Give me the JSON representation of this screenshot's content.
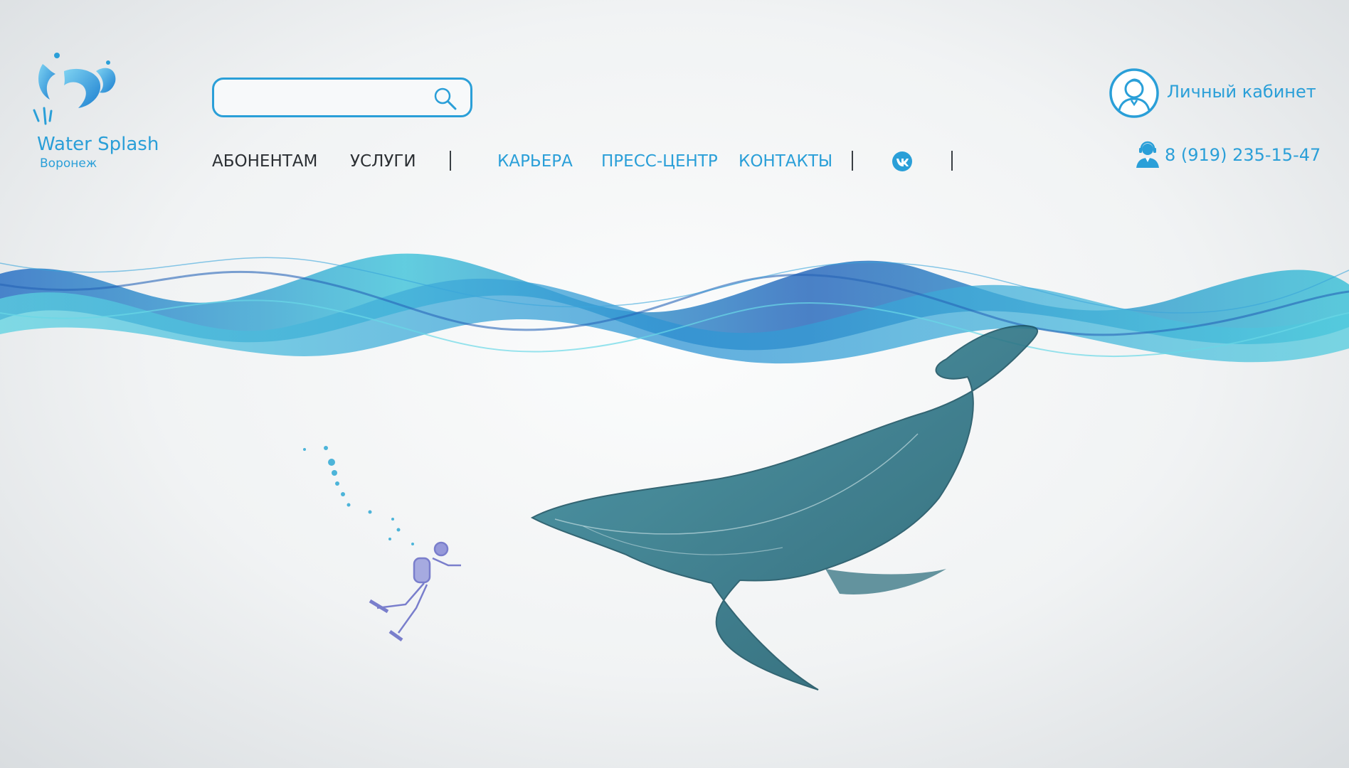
{
  "brand": {
    "name": "Water Splash",
    "city": "Воронеж",
    "icon": "water-splash-fish-logo"
  },
  "search": {
    "value": "",
    "placeholder": "",
    "icon": "search-icon"
  },
  "nav": {
    "items": [
      {
        "label": "АБОНЕНТАМ"
      },
      {
        "label": "УСЛУГИ"
      },
      {
        "label": "КАРЬЕРА"
      },
      {
        "label": "ПРЕСС-ЦЕНТР"
      },
      {
        "label": "КОНТАКТЫ"
      }
    ],
    "social_icon": "vk-icon"
  },
  "account": {
    "label": "Личный кабинет",
    "icon": "user-avatar-icon"
  },
  "contact": {
    "phone": "8 (919) 235-15-47",
    "icon": "support-agent-icon"
  },
  "colors": {
    "accent": "#2a9fd8",
    "text_dark": "#2b2f33",
    "background": "#f1f3f4",
    "wave_dark": "#1a6fc2",
    "wave_light": "#3cc4da",
    "whale": "#2f6f80"
  },
  "hero": {
    "illustration": "ocean waves with scuba diver and whale"
  }
}
